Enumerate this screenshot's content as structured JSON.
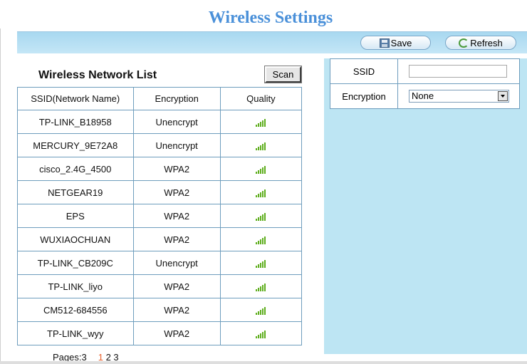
{
  "page": {
    "title": "Wireless Settings"
  },
  "toolbar": {
    "save_label": "Save",
    "refresh_label": "Refresh"
  },
  "list": {
    "title": "Wireless Network List",
    "scan_label": "Scan",
    "columns": [
      "SSID(Network Name)",
      "Encryption",
      "Quality"
    ],
    "rows": [
      {
        "ssid": "TP-LINK_B18958",
        "encryption": "Unencrypt",
        "quality_icon": "signal-full-icon"
      },
      {
        "ssid": "MERCURY_9E72A8",
        "encryption": "Unencrypt",
        "quality_icon": "signal-full-icon"
      },
      {
        "ssid": "cisco_2.4G_4500",
        "encryption": "WPA2",
        "quality_icon": "signal-full-icon"
      },
      {
        "ssid": "NETGEAR19",
        "encryption": "WPA2",
        "quality_icon": "signal-full-icon"
      },
      {
        "ssid": "EPS",
        "encryption": "WPA2",
        "quality_icon": "signal-full-icon"
      },
      {
        "ssid": "WUXIAOCHUAN",
        "encryption": "WPA2",
        "quality_icon": "signal-full-icon"
      },
      {
        "ssid": "TP-LINK_CB209C",
        "encryption": "Unencrypt",
        "quality_icon": "signal-full-icon"
      },
      {
        "ssid": "TP-LINK_liyo",
        "encryption": "WPA2",
        "quality_icon": "signal-full-icon"
      },
      {
        "ssid": "CM512-684556",
        "encryption": "WPA2",
        "quality_icon": "signal-full-icon"
      },
      {
        "ssid": "TP-LINK_wyy",
        "encryption": "WPA2",
        "quality_icon": "signal-full-icon"
      }
    ],
    "pagination": {
      "label": "Pages:3",
      "pages": [
        "1",
        "2",
        "3"
      ],
      "current": "1"
    }
  },
  "form": {
    "ssid_label": "SSID",
    "ssid_value": "",
    "encryption_label": "Encryption",
    "encryption_value": "None"
  },
  "colors": {
    "title": "#4a90d9",
    "panel": "#bde5f3",
    "border": "#6e9dbd",
    "signal": "#5fae1e",
    "current_page": "#e8602c"
  }
}
